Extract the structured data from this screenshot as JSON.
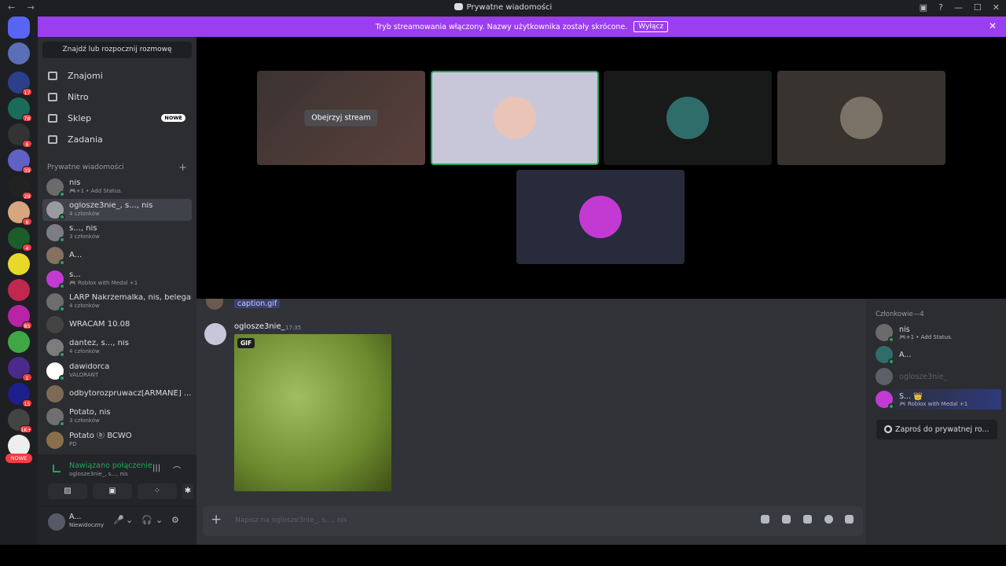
{
  "window": {
    "title": "Prywatne wiadomości",
    "nav": "← →",
    "controls": [
      "▣",
      "?",
      "—",
      "☐",
      "✕"
    ]
  },
  "banner": {
    "text": "Tryb streamowania włączony. Nazwy użytkownika zostały skrócone.",
    "button": "Wyłącz",
    "close": "✕"
  },
  "servers": {
    "badges": [
      "",
      "",
      "17",
      "78",
      "8",
      "39",
      "29",
      "8",
      "",
      "",
      "85",
      "1",
      "15",
      "1K+",
      "",
      "4"
    ],
    "new_label": "NOWE"
  },
  "sidebar": {
    "search": "Znajdź lub rozpocznij rozmowę",
    "nav": [
      {
        "label": "Znajomi",
        "icon": "friends-icon"
      },
      {
        "label": "Nitro",
        "icon": "nitro-icon"
      },
      {
        "label": "Sklep",
        "icon": "shop-icon",
        "badge": "NOWE"
      },
      {
        "label": "Zadania",
        "icon": "quests-icon"
      }
    ],
    "section": "Prywatne wiadomości",
    "section_plus": "+",
    "dms": [
      {
        "name": "nis",
        "sub": "🎮+1 • Add Status.",
        "color": "#6b6b6b"
      },
      {
        "name": "oglosze3nie_, s..., nis",
        "sub": "4 członków",
        "color": "#9a9aa3"
      },
      {
        "name": "s..., nis",
        "sub": "3 członków",
        "color": "#7b7c84"
      },
      {
        "name": "A...",
        "sub": "",
        "color": "#86705f"
      },
      {
        "name": "s...",
        "sub": "🎮 Roblox with Medal +1",
        "color": "#c33ad2"
      },
      {
        "name": "LARP Nakrzemalka, nis, belegancik",
        "sub": "4 członków",
        "color": "#6d6d6d"
      },
      {
        "name": "WRACAM 10.08",
        "sub": "",
        "color": "#444444"
      },
      {
        "name": "dantez, s..., nis",
        "sub": "4 członków",
        "color": "#7c7c7c"
      },
      {
        "name": "dawidorca",
        "sub": "VALORANT",
        "color": "#ffffff"
      },
      {
        "name": "odbytorozpruwacz[ARMANE] ...",
        "sub": "",
        "color": "#7d6a55"
      },
      {
        "name": "Potato, nis",
        "sub": "3 członków",
        "color": "#6f6f6f"
      },
      {
        "name": "Potato  ⓑ BCWO",
        "sub": "PD",
        "color": "#8b6f4a"
      }
    ]
  },
  "voice": {
    "title": "Nawiązano połączenie",
    "sub": "oglosze3nie_, s..., nis",
    "buttons": [
      "▨",
      "▣",
      "⁘",
      "✱"
    ]
  },
  "user": {
    "name": "A...",
    "status": "Niewidoczny",
    "icons": [
      "🎤",
      "⌄",
      "🎧",
      "⌄",
      "⚙"
    ]
  },
  "stage": {
    "watch_label": "Obejrzyj stream"
  },
  "chat": {
    "prev_attachment": "caption.gif",
    "author": "oglosze3nie_",
    "time": "17:35",
    "gif_tag": "GIF",
    "composer_placeholder": "Napisz na oglosze3nie_, s..., nis",
    "composer_plus": "+"
  },
  "members": {
    "header": "Członkowie—4",
    "list": [
      {
        "name": "nis",
        "sub": "🎮+1 • Add Status.",
        "color": "#6b6b6b"
      },
      {
        "name": "A...",
        "sub": "",
        "color": "#2f6d6a"
      },
      {
        "name": "oglosze3nie_",
        "sub": "",
        "color": "#5c5f66"
      },
      {
        "name": "S... 👑",
        "sub": "🎮 Roblox with Medal +1",
        "color": "#c33ad2"
      }
    ],
    "invite": "Zaproś do prywatnej ro..."
  }
}
